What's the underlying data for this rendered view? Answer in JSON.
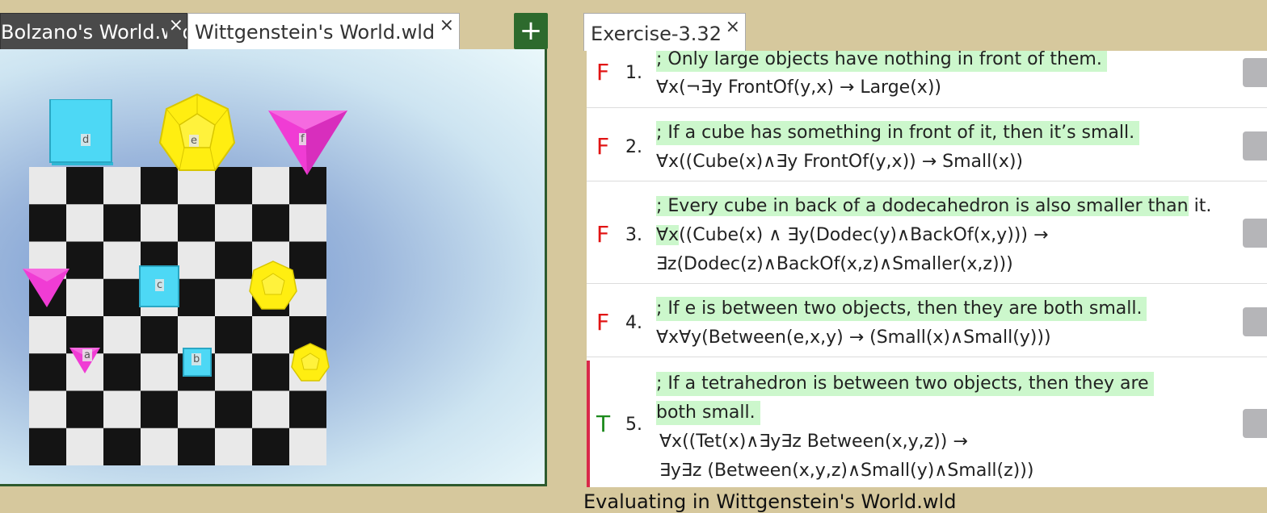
{
  "world_tabs": [
    {
      "label": "Bolzano's World.wld",
      "close": "×"
    },
    {
      "label": "Wittgenstein's World.wld",
      "close": "×"
    }
  ],
  "add_button": "+",
  "objects": {
    "a": "a",
    "b": "b",
    "c": "c",
    "d": "d",
    "e": "e",
    "f": "f"
  },
  "colors": {
    "cube": "#4dd8f5",
    "dodec": "#ffee11",
    "tet": "#f03cd4",
    "false": "#e11414",
    "true": "#1c8a1c",
    "highlight": "#ccf7cc"
  },
  "exercise_tab": {
    "label": "Exercise-3.32",
    "close": "×"
  },
  "sentences": [
    {
      "value": "F",
      "number": "1.",
      "comment": "; Only large objects have nothing in front of them.",
      "formula": [
        "∀x(¬∃y FrontOf(y,x) → Large(x))"
      ]
    },
    {
      "value": "F",
      "number": "2.",
      "comment": "; If a cube has something in front of it, then it’s small.",
      "formula": [
        "∀x((Cube(x)∧∃y FrontOf(y,x)) → Small(x))"
      ]
    },
    {
      "value": "F",
      "number": "3.",
      "comment": "; Every cube in back of a dodecahedron is also smaller than",
      "comment_tail": "it.",
      "formula_var": "∀x",
      "formula": [
        "((Cube(x) ∧ ∃y(Dodec(y)∧BackOf(x,y))) →",
        "∃z(Dodec(z)∧BackOf(x,z)∧Smaller(x,z)))"
      ]
    },
    {
      "value": "F",
      "number": "4.",
      "comment": "; If e is between two objects, then they are both small.",
      "formula": [
        "∀x∀y(Between(e,x,y) → (Small(x)∧Small(y)))"
      ]
    },
    {
      "value": "T",
      "number": "5.",
      "comment": "; If a tetrahedron is between two objects, then they are",
      "comment2": "both small.",
      "formula": [
        "∀x((Tet(x)∧∃y∃z Between(x,y,z)) →",
        "∃y∃z (Between(x,y,z)∧Small(y)∧Small(z)))"
      ]
    }
  ],
  "status": "Evaluating in Wittgenstein's World.wld"
}
